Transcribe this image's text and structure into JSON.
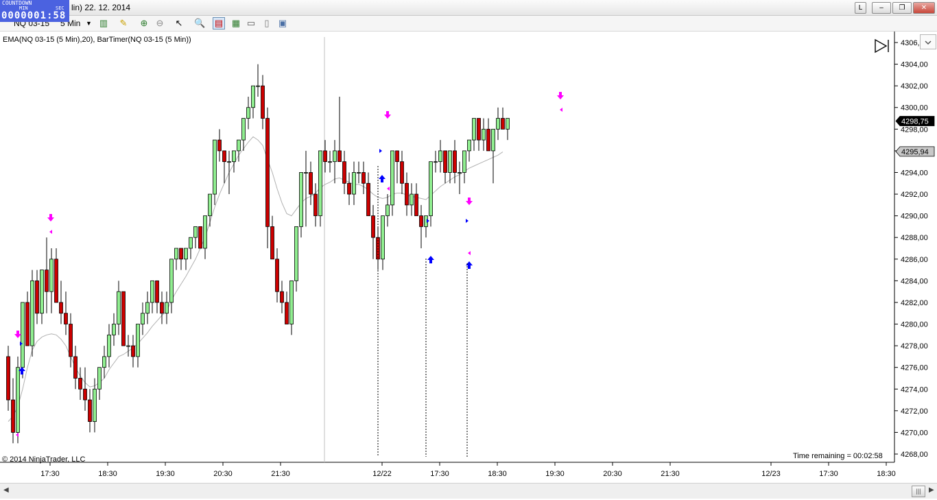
{
  "window": {
    "title_text": "lin)  22. 12. 2014",
    "buttons": [
      "L",
      "–",
      "❐",
      "✕"
    ]
  },
  "countdown": {
    "label_top": "COUNTDOWN",
    "label_min": "MIN",
    "label_sec": "SEC",
    "value": "0000001:58"
  },
  "toolbar": {
    "instrument": "NQ 03-15",
    "interval": "5 Min"
  },
  "chart": {
    "indicator_label": "EMA(NQ 03-15 (5 Min),20), BarTimer(NQ 03-15 (5 Min))",
    "copyright": "© 2014 NinjaTrader, LLC",
    "time_remaining": "Time remaining = 00:02:58",
    "last_price_label": "4298,75",
    "ema_price_label": "4295,94",
    "colors": {
      "up": "#90ee90",
      "down": "#cc0000",
      "ema": "#b0b0b0",
      "sell_arrow": "#ff00ff",
      "buy_arrow": "#0000ff"
    }
  },
  "chart_data": {
    "type": "candlestick",
    "title": "",
    "y_axis_ticks": [
      "4306,00",
      "4304,00",
      "4302,00",
      "4300,00",
      "4298,00",
      "4296,00",
      "4294,00",
      "4292,00",
      "4290,00",
      "4288,00",
      "4286,00",
      "4284,00",
      "4282,00",
      "4280,00",
      "4278,00",
      "4276,00",
      "4274,00",
      "4272,00",
      "4270,00",
      "4268,00"
    ],
    "x_axis_ticks": [
      "17:30",
      "18:30",
      "19:30",
      "20:30",
      "21:30",
      "12/22",
      "17:30",
      "18:30",
      "19:30",
      "20:30",
      "21:30",
      "12/23",
      "17:30",
      "18:30"
    ],
    "ylim": [
      4267.5,
      4306.2
    ],
    "candles": [
      [
        4277,
        4278,
        4272,
        4273
      ],
      [
        4273,
        4275,
        4269,
        4270
      ],
      [
        4270,
        4277,
        4269,
        4276
      ],
      [
        4276,
        4282,
        4275,
        4282
      ],
      [
        4282,
        4283,
        4278,
        4278
      ],
      [
        4278,
        4285,
        4277,
        4284
      ],
      [
        4284,
        4285,
        4280,
        4281
      ],
      [
        4281,
        4285,
        4280,
        4285
      ],
      [
        4285,
        4288,
        4281,
        4283
      ],
      [
        4283,
        4287,
        4281,
        4286
      ],
      [
        4286,
        4287,
        4282,
        4282
      ],
      [
        4282,
        4284,
        4280,
        4281
      ],
      [
        4281,
        4283,
        4279,
        4280
      ],
      [
        4280,
        4281,
        4276,
        4277
      ],
      [
        4277,
        4278,
        4274,
        4275
      ],
      [
        4275,
        4276,
        4273,
        4274
      ],
      [
        4274,
        4276,
        4272,
        4273
      ],
      [
        4273,
        4274,
        4270,
        4271
      ],
      [
        4271,
        4275,
        4270,
        4274
      ],
      [
        4274,
        4276,
        4273,
        4276
      ],
      [
        4276,
        4278,
        4275,
        4277
      ],
      [
        4277,
        4280,
        4276,
        4279
      ],
      [
        4279,
        4281,
        4278,
        4280
      ],
      [
        4280,
        4284,
        4279,
        4283
      ],
      [
        4283,
        4283,
        4278,
        4278
      ],
      [
        4278,
        4279,
        4277,
        4278
      ],
      [
        4278,
        4279,
        4276,
        4277
      ],
      [
        4277,
        4280,
        4276,
        4280
      ],
      [
        4280,
        4282,
        4279,
        4281
      ],
      [
        4281,
        4283,
        4280,
        4282
      ],
      [
        4282,
        4284,
        4281,
        4284
      ],
      [
        4284,
        4284,
        4281,
        4282
      ],
      [
        4282,
        4283,
        4280,
        4281
      ],
      [
        4281,
        4283,
        4280,
        4282
      ],
      [
        4282,
        4286,
        4281,
        4286
      ],
      [
        4286,
        4287,
        4285,
        4287
      ],
      [
        4287,
        4287,
        4285,
        4286
      ],
      [
        4286,
        4287,
        4285,
        4287
      ],
      [
        4287,
        4288,
        4286,
        4288
      ],
      [
        4288,
        4289,
        4287,
        4289
      ],
      [
        4289,
        4289,
        4287,
        4287
      ],
      [
        4287,
        4290,
        4286,
        4290
      ],
      [
        4290,
        4292,
        4289,
        4292
      ],
      [
        4292,
        4297,
        4291,
        4297
      ],
      [
        4297,
        4298,
        4295,
        4296
      ],
      [
        4296,
        4296,
        4293,
        4295
      ],
      [
        4295,
        4296,
        4292,
        4295
      ],
      [
        4295,
        4296,
        4294,
        4296
      ],
      [
        4296,
        4297,
        4295,
        4297
      ],
      [
        4297,
        4299,
        4296,
        4299
      ],
      [
        4299,
        4301,
        4298,
        4300
      ],
      [
        4300,
        4302,
        4299,
        4302
      ],
      [
        4302,
        4304,
        4301,
        4302
      ],
      [
        4302,
        4303,
        4298,
        4299
      ],
      [
        4299,
        4300,
        4287,
        4289
      ],
      [
        4289,
        4290,
        4286,
        4286
      ],
      [
        4286,
        4287,
        4282,
        4283
      ],
      [
        4283,
        4284,
        4281,
        4282
      ],
      [
        4282,
        4283,
        4280,
        4280
      ],
      [
        4280,
        4284,
        4279,
        4284
      ],
      [
        4284,
        4289,
        4283,
        4289
      ],
      [
        4289,
        4294,
        4288,
        4294
      ],
      [
        4294,
        4296,
        4289,
        4294
      ],
      [
        4294,
        4295,
        4291,
        4292
      ],
      [
        4292,
        4293,
        4289,
        4290
      ],
      [
        4290,
        4296,
        4289,
        4296
      ],
      [
        4296,
        4297,
        4294,
        4295
      ],
      [
        4295,
        4296,
        4294,
        4295
      ],
      [
        4295,
        4297,
        4293,
        4296
      ],
      [
        4296,
        4301,
        4295,
        4295
      ],
      [
        4295,
        4296,
        4292,
        4293
      ],
      [
        4293,
        4294,
        4291,
        4292
      ],
      [
        4292,
        4295,
        4291,
        4294
      ],
      [
        4294,
        4295,
        4293,
        4294
      ],
      [
        4294,
        4295,
        4292,
        4293
      ],
      [
        4293,
        4294,
        4290,
        4290
      ],
      [
        4290,
        4291,
        4286,
        4288
      ],
      [
        4288,
        4289,
        4285,
        4286
      ],
      [
        4286,
        4290,
        4285,
        4290
      ],
      [
        4290,
        4292,
        4289,
        4291
      ],
      [
        4291,
        4296,
        4290,
        4296
      ],
      [
        4296,
        4296,
        4293,
        4295
      ],
      [
        4295,
        4296,
        4292,
        4293
      ],
      [
        4293,
        4294,
        4290,
        4291
      ],
      [
        4291,
        4293,
        4290,
        4292
      ],
      [
        4292,
        4293,
        4290,
        4290
      ],
      [
        4290,
        4291,
        4287,
        4289
      ],
      [
        4289,
        4290,
        4288,
        4290
      ],
      [
        4290,
        4295,
        4289,
        4295
      ],
      [
        4295,
        4296,
        4294,
        4295
      ],
      [
        4295,
        4297,
        4294,
        4296
      ],
      [
        4296,
        4296,
        4293,
        4294
      ],
      [
        4294,
        4296,
        4293,
        4296
      ],
      [
        4296,
        4297,
        4293,
        4294
      ],
      [
        4294,
        4295,
        4292,
        4294
      ],
      [
        4294,
        4296,
        4293,
        4296
      ],
      [
        4296,
        4297,
        4295,
        4297
      ],
      [
        4297,
        4299,
        4296,
        4299
      ],
      [
        4299,
        4299,
        4296,
        4297
      ],
      [
        4297,
        4299,
        4296,
        4298
      ],
      [
        4298,
        4299,
        4296,
        4296
      ],
      [
        4296,
        4298,
        4293,
        4298
      ],
      [
        4298,
        4300,
        4297,
        4299
      ],
      [
        4299,
        4300,
        4298,
        4298
      ],
      [
        4298,
        4299,
        4297,
        4299
      ]
    ],
    "ema": [
      4271,
      4271.5,
      4272.4,
      4274,
      4276,
      4277.6,
      4278.4,
      4278.8,
      4279,
      4279.1,
      4279,
      4278.6,
      4278,
      4277,
      4276,
      4275.2,
      4274.6,
      4274.2,
      4274.3,
      4274.6,
      4275,
      4275.8,
      4276.4,
      4277,
      4277.2,
      4277.5,
      4277.8,
      4278.2,
      4278.7,
      4279.2,
      4279.8,
      4280.3,
      4280.8,
      4281.2,
      4282.2,
      4283,
      4283.7,
      4284.4,
      4285.2,
      4286,
      4287,
      4288,
      4289.4,
      4290.8,
      4292,
      4293,
      4294,
      4294.8,
      4295.6,
      4296.2,
      4296.8,
      4297.3,
      4297,
      4296.5,
      4295.2,
      4294,
      4292.5,
      4291.2,
      4290.2,
      4290,
      4290.6,
      4291.2,
      4291.6,
      4291.8,
      4292.1,
      4292.6,
      4292.9,
      4293.1,
      4293.4,
      4293.5,
      4293.3,
      4293.1,
      4292.9,
      4292.9,
      4292.7,
      4292.4,
      4292,
      4291.7,
      4291.6,
      4291.7,
      4292,
      4292.1,
      4292.1,
      4291.9,
      4291.8,
      4291.7,
      4291.6,
      4291.5,
      4291.9,
      4292.3,
      4292.7,
      4293,
      4293.3,
      4293.6,
      4293.8,
      4294.1,
      4294.4,
      4294.6,
      4294.8,
      4295,
      4295.2,
      4295.4,
      4295.6,
      4295.9
    ]
  }
}
